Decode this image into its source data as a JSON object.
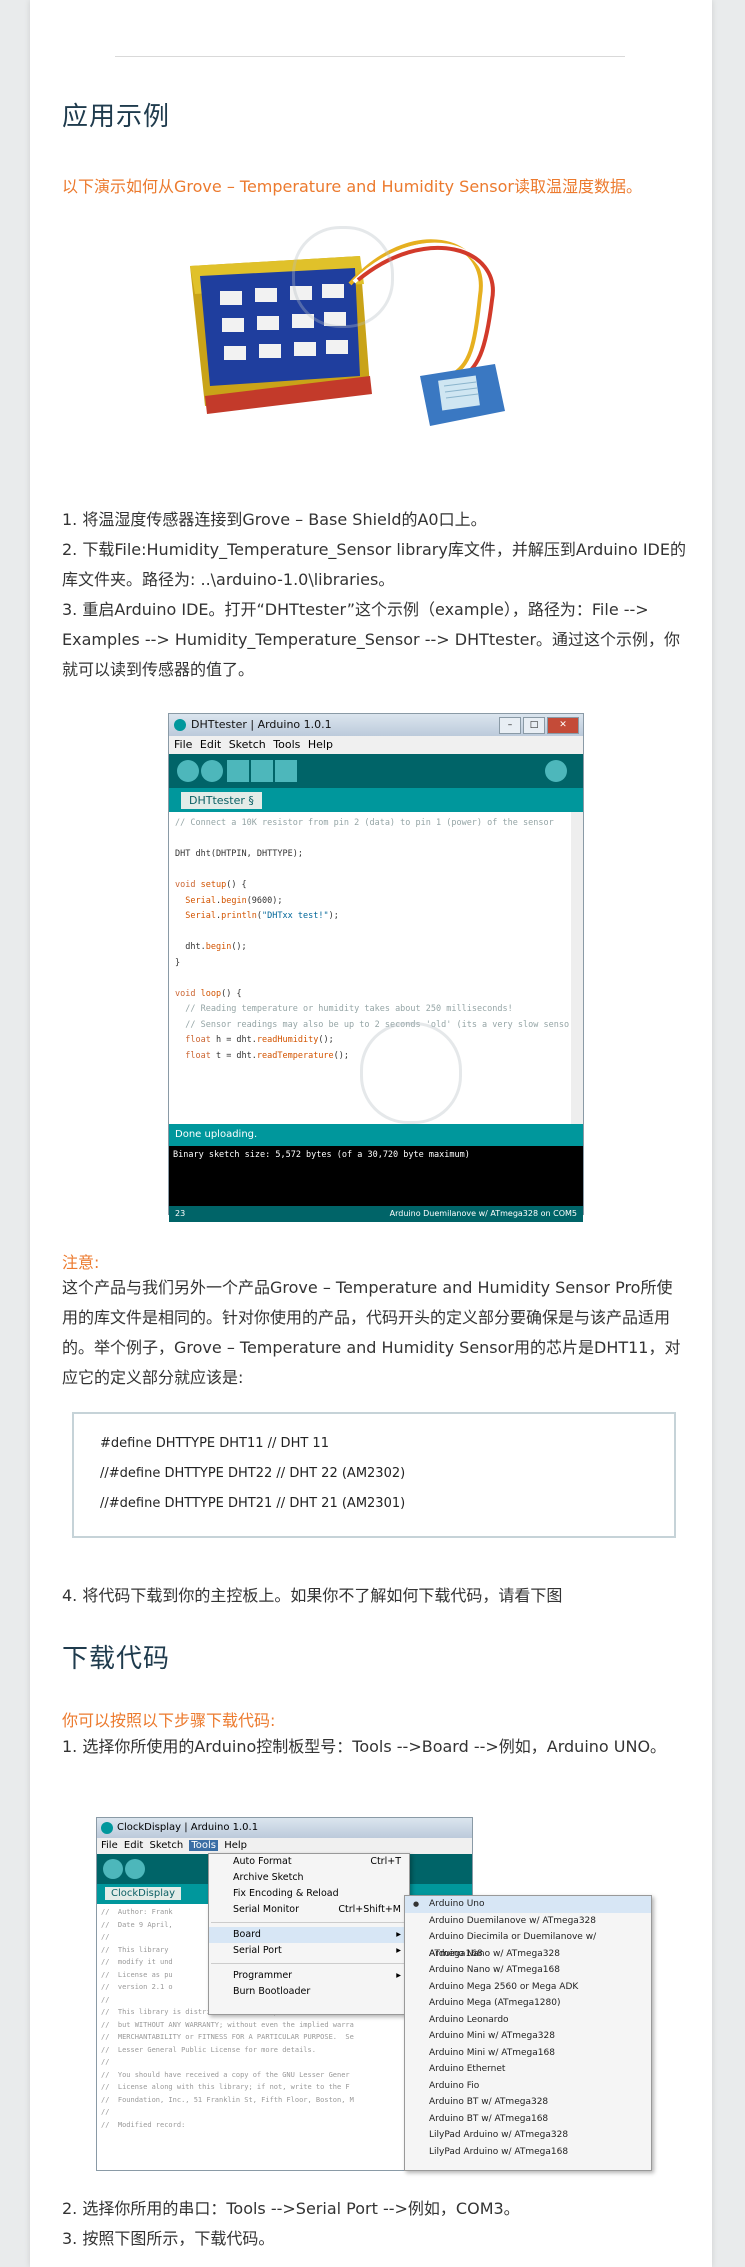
{
  "section1": {
    "heading": "应用示例",
    "intro": "以下演示如何从Grove – Temperature and Humidity Sensor读取温湿度数据。",
    "steps": [
      "1. 将温湿度传感器连接到Grove – Base Shield的A0口上。",
      "2. 下载File:Humidity_Temperature_Sensor library库文件，并解压到Arduino IDE的库文件夹。路径为: ..\\arduino-1.0\\libraries。",
      "3. 重启Arduino IDE。打开“DHTtester”这个示例（example），路径为：File --> Examples --> Humidity_Temperature_Sensor --> DHTtester。通过这个示例，你就可以读到传感器的值了。"
    ]
  },
  "ide1": {
    "title": "DHTtester | Arduino 1.0.1",
    "menu": "File  Edit  Sketch  Tools  Help",
    "tab": "DHTtester §",
    "status": "Done uploading.",
    "console": "Binary sketch size: 5,572 bytes (of a 30,720 byte maximum)",
    "line_number": "23",
    "board": "Arduino Duemilanove w/ ATmega328 on COM5"
  },
  "note": {
    "label": "注意:",
    "text": "这个产品与我们另外一个产品Grove – Temperature and Humidity Sensor Pro所使用的库文件是相同的。针对你使用的产品，代码开头的定义部分要确保是与该产品适用的。举个例子，Grove – Temperature and Humidity Sensor用的芯片是DHT11，对应它的定义部分就应该是:",
    "defines": [
      "#define DHTTYPE DHT11   // DHT 11",
      "//#define DHTTYPE DHT22   // DHT 22  (AM2302)",
      "//#define DHTTYPE DHT21   // DHT 21 (AM2301)"
    ],
    "step4": "4. 将代码下载到你的主控板上。如果你不了解如何下载代码，请看下图"
  },
  "section2": {
    "heading": "下载代码",
    "intro": "你可以按照以下步骤下载代码:",
    "step1": "1. 选择你所使用的Arduino控制板型号：Tools -->Board -->例如，Arduino UNO。",
    "step2": "2. 选择你所用的串口：Tools -->Serial Port -->例如，COM3。",
    "step3": "3. 按照下图所示，下载代码。"
  },
  "ide2": {
    "title": "ClockDisplay | Arduino 1.0.1",
    "menu_items": [
      "File",
      "Edit",
      "Sketch",
      "Tools",
      "Help"
    ],
    "tab": "ClockDisplay",
    "tools_menu": [
      {
        "label": "Auto Format",
        "shortcut": "Ctrl+T"
      },
      {
        "label": "Archive Sketch",
        "shortcut": ""
      },
      {
        "label": "Fix Encoding & Reload",
        "shortcut": ""
      },
      {
        "label": "Serial Monitor",
        "shortcut": "Ctrl+Shift+M"
      },
      {
        "label": "Board",
        "shortcut": "▸"
      },
      {
        "label": "Serial Port",
        "shortcut": "▸"
      },
      {
        "label": "Programmer",
        "shortcut": "▸"
      },
      {
        "label": "Burn Bootloader",
        "shortcut": ""
      }
    ],
    "boards": [
      "Arduino Uno",
      "Arduino Duemilanove w/ ATmega328",
      "Arduino Diecimila or Duemilanove w/ ATmega168",
      "Arduino Nano w/ ATmega328",
      "Arduino Nano w/ ATmega168",
      "Arduino Mega 2560 or Mega ADK",
      "Arduino Mega (ATmega1280)",
      "Arduino Leonardo",
      "Arduino Mini w/ ATmega328",
      "Arduino Mini w/ ATmega168",
      "Arduino Ethernet",
      "Arduino Fio",
      "Arduino BT w/ ATmega328",
      "Arduino BT w/ ATmega168",
      "LilyPad Arduino w/ ATmega328",
      "LilyPad Arduino w/ ATmega168"
    ]
  },
  "colors": {
    "accent_orange": "#ec7a2e",
    "heading": "#1f3b4d",
    "arduino_teal": "#00979c"
  }
}
